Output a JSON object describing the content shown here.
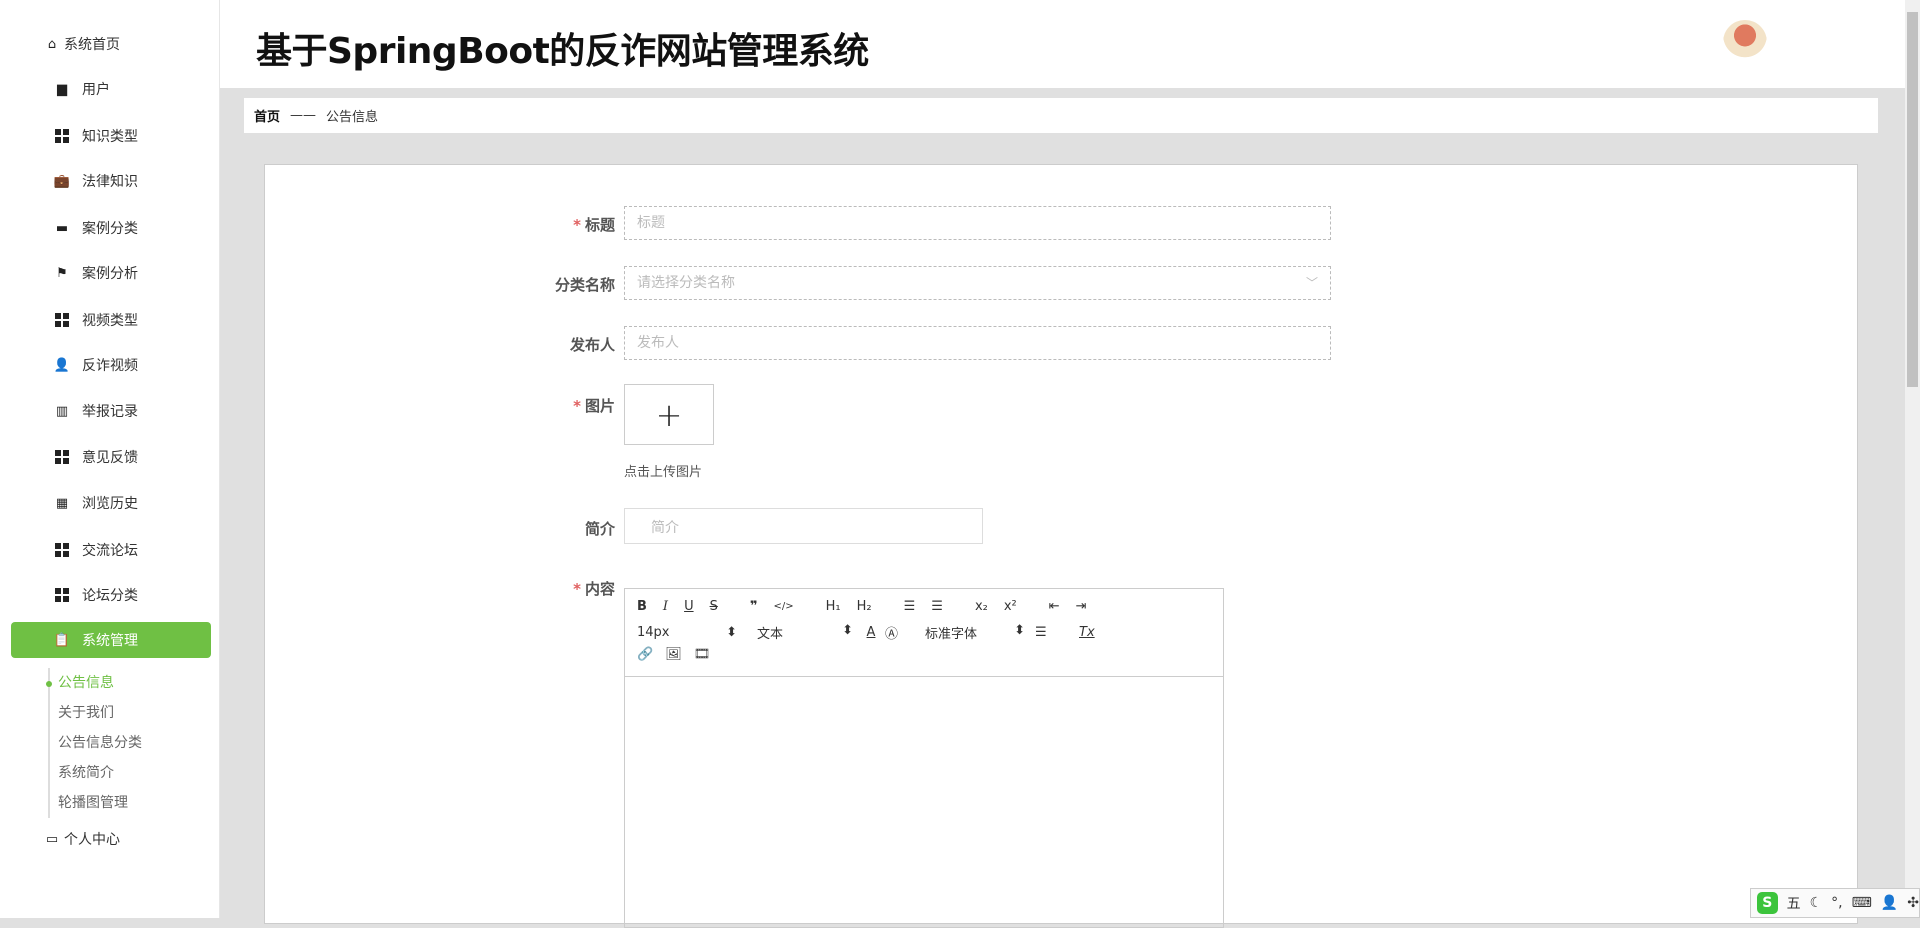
{
  "header": {
    "title": "基于SpringBoot的反诈网站管理系统"
  },
  "breadcrumb": {
    "home": "首页",
    "separator": "——",
    "current": "公告信息"
  },
  "sidebar": {
    "items": [
      {
        "label": "系统首页",
        "icon": "home-icon"
      },
      {
        "label": "用户",
        "icon": "user-card-icon"
      },
      {
        "label": "知识类型",
        "icon": "grid-icon"
      },
      {
        "label": "法律知识",
        "icon": "briefcase-icon"
      },
      {
        "label": "案例分类",
        "icon": "comment-icon"
      },
      {
        "label": "案例分析",
        "icon": "flag-icon"
      },
      {
        "label": "视频类型",
        "icon": "grid-icon"
      },
      {
        "label": "反诈视频",
        "icon": "person-icon"
      },
      {
        "label": "举报记录",
        "icon": "book-icon"
      },
      {
        "label": "意见反馈",
        "icon": "grid-icon"
      },
      {
        "label": "浏览历史",
        "icon": "grid9-icon"
      },
      {
        "label": "交流论坛",
        "icon": "grid-icon"
      },
      {
        "label": "论坛分类",
        "icon": "grid-icon"
      },
      {
        "label": "系统管理",
        "icon": "clipboard-icon"
      }
    ],
    "sub_items": [
      "公告信息",
      "关于我们",
      "公告信息分类",
      "系统简介",
      "轮播图管理"
    ],
    "personal": "个人中心",
    "accent": "#6fc044"
  },
  "form": {
    "title_label": "标题",
    "title_placeholder": "标题",
    "category_label": "分类名称",
    "category_placeholder": "请选择分类名称",
    "publisher_label": "发布人",
    "publisher_placeholder": "发布人",
    "image_label": "图片",
    "upload_hint": "点击上传图片",
    "intro_label": "简介",
    "intro_placeholder": "简介",
    "content_label": "内容",
    "required_mark": "*"
  },
  "editor": {
    "font_size": "14px",
    "header": "文本",
    "font": "标准字体"
  },
  "ime": {
    "mode": "五"
  }
}
